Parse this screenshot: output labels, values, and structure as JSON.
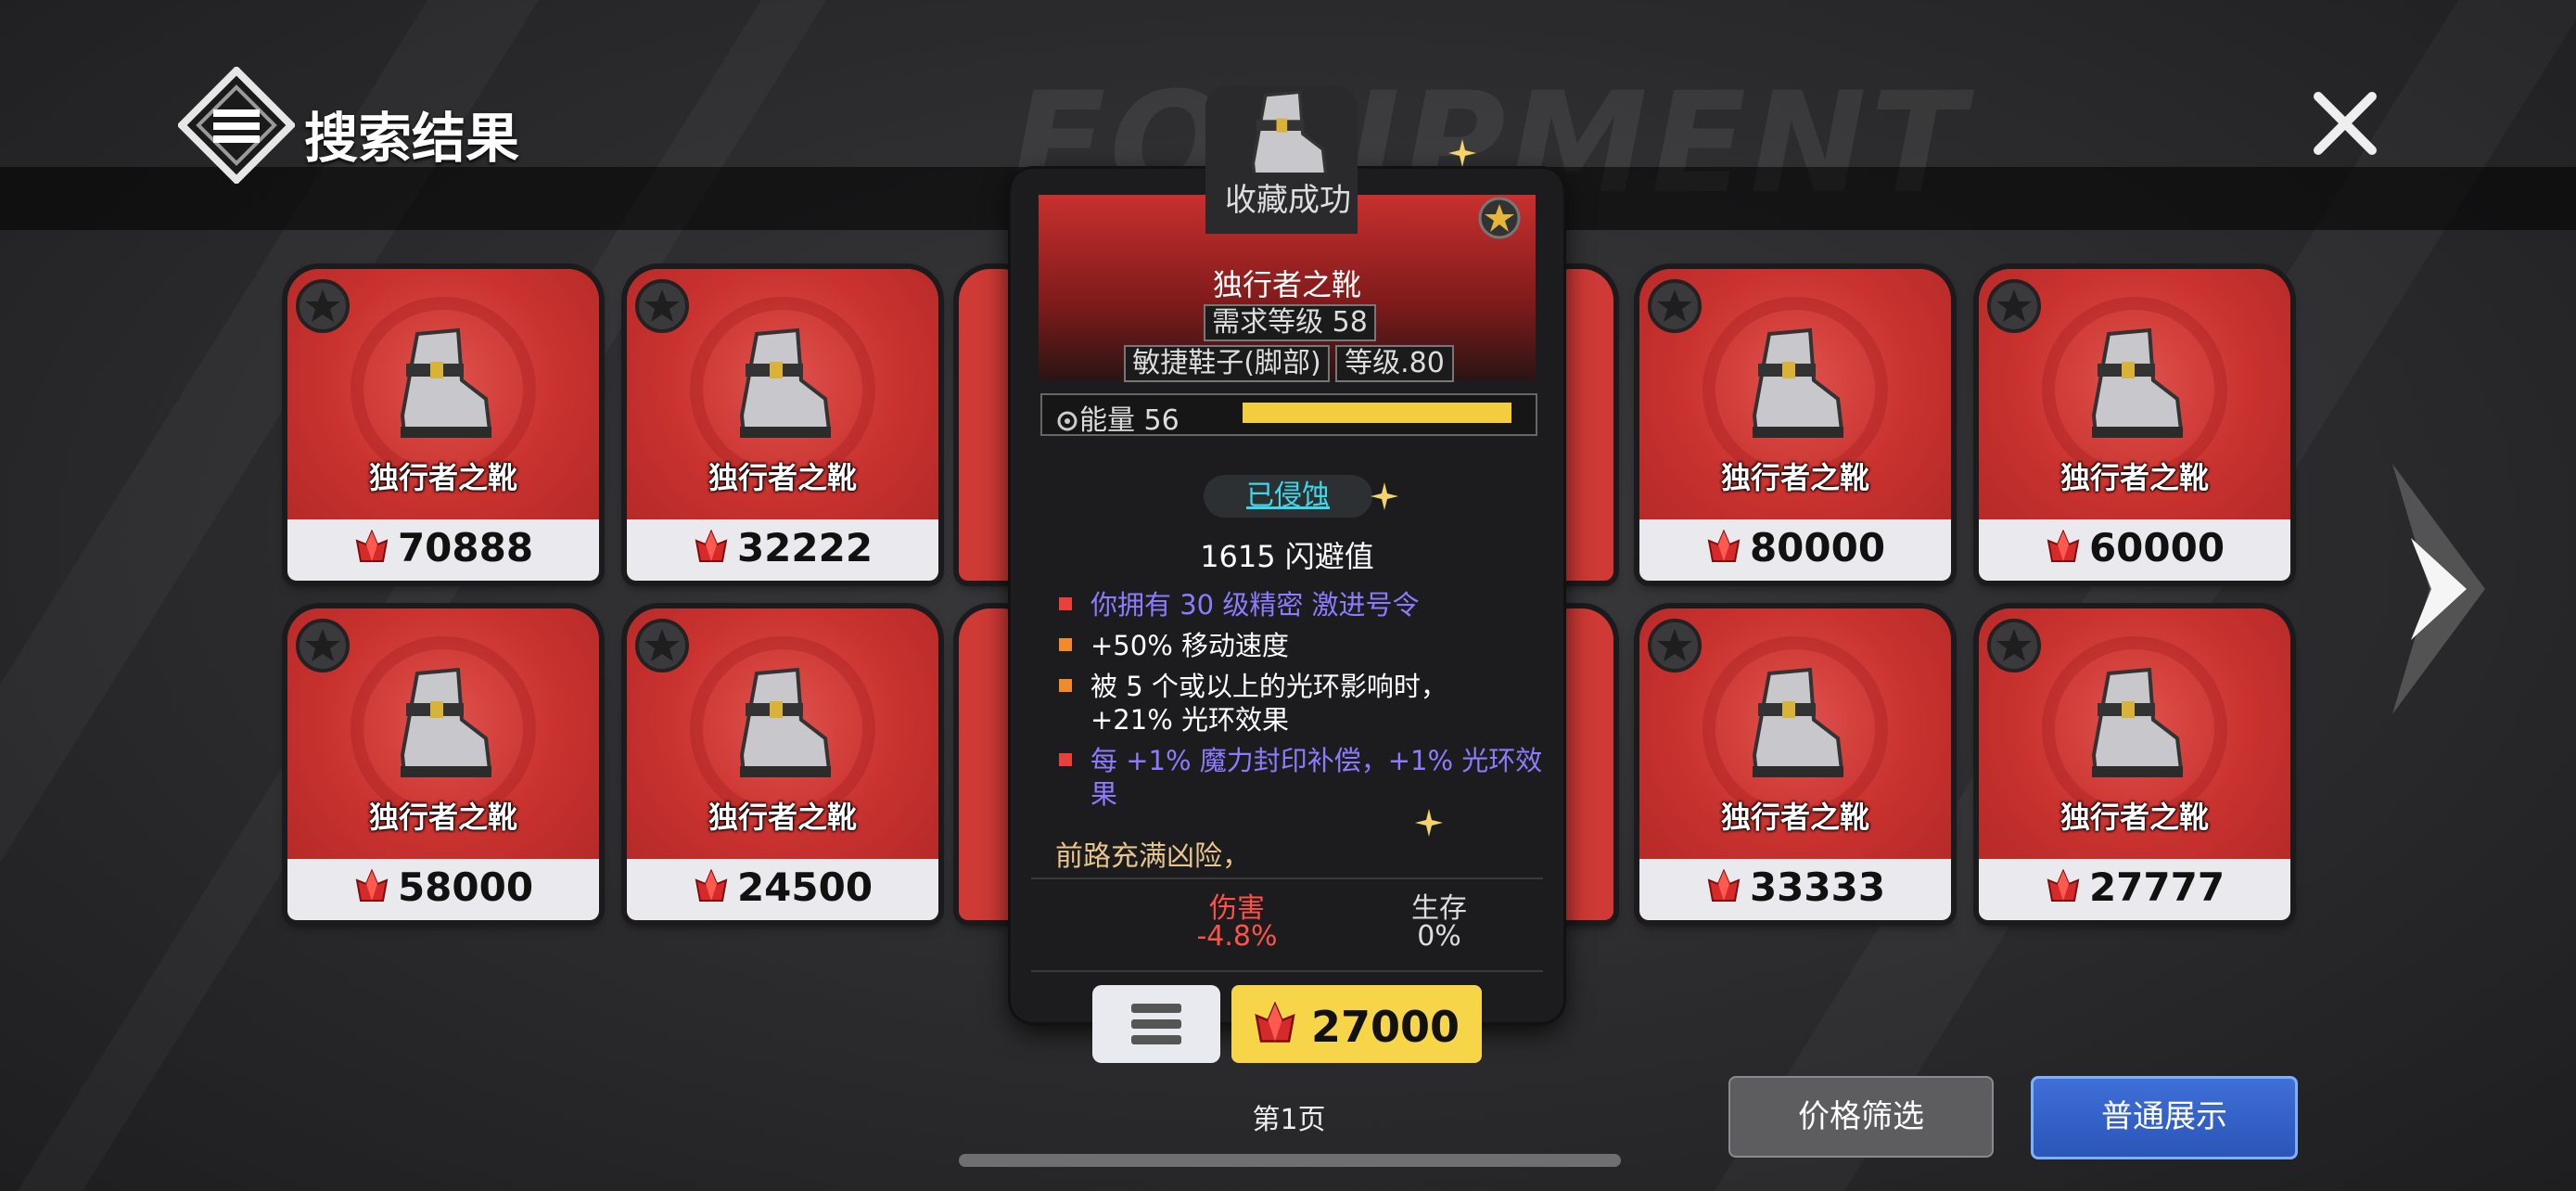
{
  "header": {
    "title": "搜索结果"
  },
  "watermark": "EQUIPMENT",
  "items": [
    {
      "name": "独行者之靴",
      "price": "70888",
      "starred": false
    },
    {
      "name": "独行者之靴",
      "price": "32222",
      "starred": false
    },
    {
      "name": "独行者之靴",
      "price": "80000",
      "starred": false
    },
    {
      "name": "独行者之靴",
      "price": "60000",
      "starred": false
    },
    {
      "name": "独行者之靴",
      "price": "58000",
      "starred": false
    },
    {
      "name": "独行者之靴",
      "price": "24500",
      "starred": false
    },
    {
      "name": "独行者之靴",
      "price": "33333",
      "starred": false
    },
    {
      "name": "独行者之靴",
      "price": "27777",
      "starred": false
    }
  ],
  "detail": {
    "toast": "收藏成功",
    "name": "独行者之靴",
    "required_level": "需求等级 58",
    "type": "敏捷鞋子(脚部)",
    "item_level": "等级.80",
    "energy_label": "能量 56",
    "energy_fill_pct": 100,
    "corruption_status": "已侵蚀",
    "main_stat": "1615 闪避值",
    "affixes": [
      {
        "text": "你拥有 30 级精密 激进号令",
        "color": "#8b7cff",
        "bullet": "#e8403a"
      },
      {
        "text": "+50% 移动速度",
        "color": "#ffffff",
        "bullet": "#f08a2c"
      },
      {
        "text": "被 5 个或以上的光环影响时，",
        "text2": "+21% 光环效果",
        "color": "#ffffff",
        "bullet": "#f08a2c"
      },
      {
        "text": "每 +1% 魔力封印补偿，+1% 光环效",
        "text2": "果",
        "color": "#8b7cff",
        "bullet": "#e8403a"
      }
    ],
    "flavor": "前路充满凶险，",
    "compare": [
      {
        "label": "伤害",
        "value": "-4.8%",
        "color": "#ff5147"
      },
      {
        "label": "生存",
        "value": "0%",
        "color": "#dddddd"
      }
    ],
    "buy_price": "27000"
  },
  "footer": {
    "page": "第1页",
    "filter_button": "价格筛选",
    "display_button": "普通展示"
  },
  "colors": {
    "card_red": "#cf3a36",
    "accent_blue": "#3f6fd8",
    "buy_yellow": "#f7d548"
  }
}
